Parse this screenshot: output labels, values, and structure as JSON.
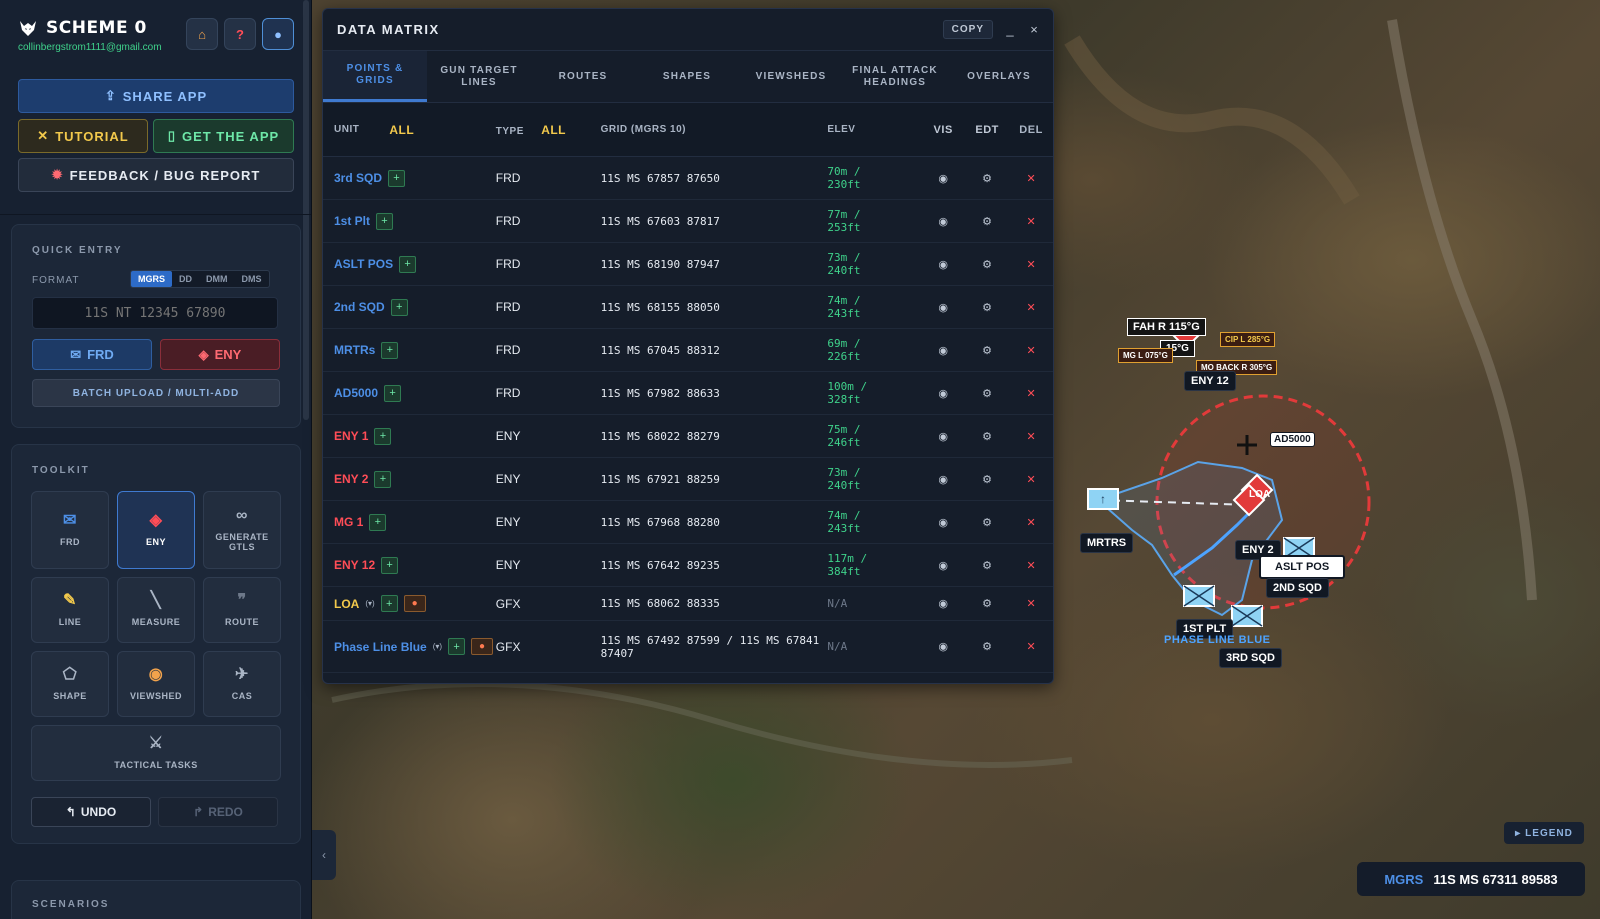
{
  "sidebar": {
    "brand": "SCHEME 0",
    "email": "collinbergstrom1111@gmail.com",
    "share_label": "SHARE APP",
    "tutorial_label": "TUTORIAL",
    "getapp_label": "GET THE APP",
    "feedback_label": "FEEDBACK / BUG REPORT",
    "quick_entry": {
      "title": "QUICK ENTRY",
      "format_label": "FORMAT",
      "formats": [
        "MGRS",
        "DD",
        "DMM",
        "DMS"
      ],
      "active_format": "MGRS",
      "placeholder": "11S NT 12345 67890",
      "frd_label": "FRD",
      "eny_label": "ENY",
      "batch_label": "BATCH UPLOAD / MULTI-ADD"
    },
    "toolkit": {
      "title": "TOOLKIT",
      "tools": [
        {
          "label": "FRD",
          "icon": "frd-icon"
        },
        {
          "label": "ENY",
          "icon": "eny-icon"
        },
        {
          "label": "GENERATE GTLS",
          "icon": "link-icon"
        },
        {
          "label": "LINE",
          "icon": "pencil-icon"
        },
        {
          "label": "MEASURE",
          "icon": "ruler-icon"
        },
        {
          "label": "ROUTE",
          "icon": "footprints-icon"
        },
        {
          "label": "SHAPE",
          "icon": "pentagon-icon"
        },
        {
          "label": "VIEWSHED",
          "icon": "eye-icon"
        },
        {
          "label": "CAS",
          "icon": "airplane-icon"
        },
        {
          "label": "TACTICAL TASKS",
          "icon": "crossed-swords-icon"
        }
      ],
      "active_tool": "ENY",
      "undo_label": "UNDO",
      "redo_label": "REDO"
    },
    "scenarios_title": "SCENARIOS"
  },
  "matrix": {
    "title": "DATA MATRIX",
    "copy_label": "COPY",
    "minimize_label": "_",
    "close_label": "×",
    "tabs": [
      "POINTS & GRIDS",
      "GUN TARGET LINES",
      "ROUTES",
      "SHAPES",
      "VIEWSHEDS",
      "FINAL ATTACK HEADINGS",
      "OVERLAYS"
    ],
    "active_tab": "POINTS & GRIDS",
    "columns": {
      "unit": "UNIT",
      "unit_filter": "ALL",
      "type": "TYPE",
      "type_filter": "ALL",
      "grid": "GRID (MGRS 10)",
      "elev": "ELEV",
      "vis": "VIS",
      "edt": "EDT",
      "del": "DEL"
    },
    "rows": [
      {
        "unit": "3rd SQD",
        "type": "FRD",
        "grid": "11S MS 67857 87650",
        "elev_m": "70m /",
        "elev_ft": "230ft"
      },
      {
        "unit": "1st Plt",
        "type": "FRD",
        "grid": "11S MS 67603 87817",
        "elev_m": "77m /",
        "elev_ft": "253ft"
      },
      {
        "unit": "ASLT POS",
        "type": "FRD",
        "grid": "11S MS 68190 87947",
        "elev_m": "73m /",
        "elev_ft": "240ft"
      },
      {
        "unit": "2nd SQD",
        "type": "FRD",
        "grid": "11S MS 68155 88050",
        "elev_m": "74m /",
        "elev_ft": "243ft"
      },
      {
        "unit": "MRTRs",
        "type": "FRD",
        "grid": "11S MS 67045 88312",
        "elev_m": "69m /",
        "elev_ft": "226ft"
      },
      {
        "unit": "AD5000",
        "type": "FRD",
        "grid": "11S MS 67982 88633",
        "elev_m": "100m /",
        "elev_ft": "328ft"
      },
      {
        "unit": "ENY 1",
        "type": "ENY",
        "grid": "11S MS 68022 88279",
        "elev_m": "75m /",
        "elev_ft": "246ft"
      },
      {
        "unit": "ENY 2",
        "type": "ENY",
        "grid": "11S MS 67921 88259",
        "elev_m": "73m /",
        "elev_ft": "240ft"
      },
      {
        "unit": "MG 1",
        "type": "ENY",
        "grid": "11S MS 67968 88280",
        "elev_m": "74m /",
        "elev_ft": "243ft"
      },
      {
        "unit": "ENY 12",
        "type": "ENY",
        "grid": "11S MS 67642 89235",
        "elev_m": "117m /",
        "elev_ft": "384ft"
      },
      {
        "unit": "LOA",
        "type": "GFX",
        "grid": "11S MS 68062 88335",
        "elev_m": "N/A",
        "elev_ft": "",
        "tag": "(▾)"
      },
      {
        "unit": "Phase Line Blue",
        "type": "GFX",
        "grid": "11S MS 67492 87599 / 11S MS 67841 87407",
        "elev_m": "N/A",
        "elev_ft": "",
        "tag": "(▾)"
      }
    ],
    "vis_icon": "eye-icon",
    "edt_icon": "gear-icon",
    "del_icon": "close-icon"
  },
  "map": {
    "legend_label": "LEGEND",
    "mgrs_label": "MGRS",
    "mgrs_value": "11S MS 67311 89583",
    "labels": {
      "fah": "FAH R 115°G",
      "fah2": "15°G",
      "cip": "CIP L 285°G",
      "mg_l": "MG L 075°G",
      "mo_back": "MO BACK R 305°G",
      "eny12": "ENY 12",
      "ad5000": "AD5000",
      "loa": "LOA",
      "mrtrs": "MRTRS",
      "eny2": "ENY 2",
      "aslt": "ASLT POS",
      "sqd2": "2ND SQD",
      "plt1": "1ST PLT",
      "phase": "PHASE LINE BLUE",
      "sqd3": "3RD SQD"
    }
  }
}
